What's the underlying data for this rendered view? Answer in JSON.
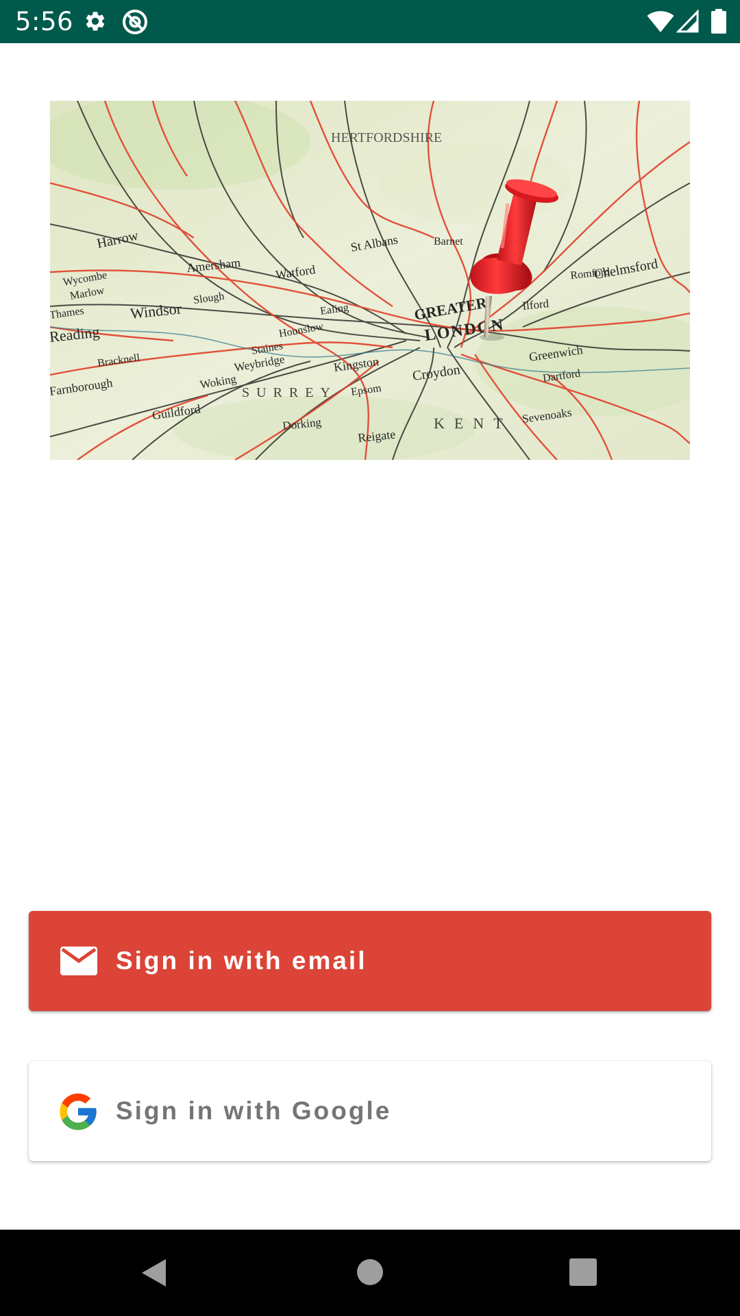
{
  "status_bar": {
    "time": "5:56",
    "background_color": "#00594b",
    "left_icons": [
      "settings-gear-icon",
      "do-not-disturb-at-icon"
    ],
    "right_icons": [
      "wifi-icon",
      "cellular-signal-icon",
      "battery-icon"
    ]
  },
  "hero_image": {
    "description_icon": "map-with-red-pushpin-image",
    "map_text": {
      "hertfordshire": "HERTFORDSHIRE",
      "greater": "GREATER",
      "london": "LONDON",
      "windsor": "Windsor",
      "reading": "Reading",
      "croydon": "Croydon",
      "kingston": "Kingston",
      "greenwich": "Greenwich",
      "chelmsford": "Chelmsford",
      "woking": "Woking",
      "slough": "Slough",
      "watford": "Watford",
      "amersham": "Amersham",
      "st_albans": "St Albans",
      "hounslow": "Hounslow",
      "staines": "Staines",
      "epsom": "Epsom",
      "sevenoaks": "Sevenoaks",
      "ilford": "Ilford",
      "dartford": "Dartford",
      "weybridge": "Weybridge",
      "guildford": "Guildford",
      "dorking": "Dorking",
      "reigate": "Reigate",
      "marlow": "Marlow",
      "wycombe": "Wycombe",
      "harrow": "Harrow",
      "barnet": "Barnet",
      "bracknell": "Bracknell",
      "farnborough": "Farnborough",
      "thames": "Thames",
      "romford": "Romford",
      "ealing": "Ealing",
      "surrey": "SURREY",
      "kent": "KENT"
    }
  },
  "buttons": {
    "email": {
      "label": "Sign in with email",
      "icon": "email-envelope-icon",
      "color": "#db4437"
    },
    "google": {
      "label": "Sign in with Google",
      "icon": "google-g-logo-icon",
      "color": "#ffffff"
    }
  },
  "nav_bar": {
    "buttons": [
      "back-triangle-icon",
      "home-circle-icon",
      "recents-square-icon"
    ]
  }
}
